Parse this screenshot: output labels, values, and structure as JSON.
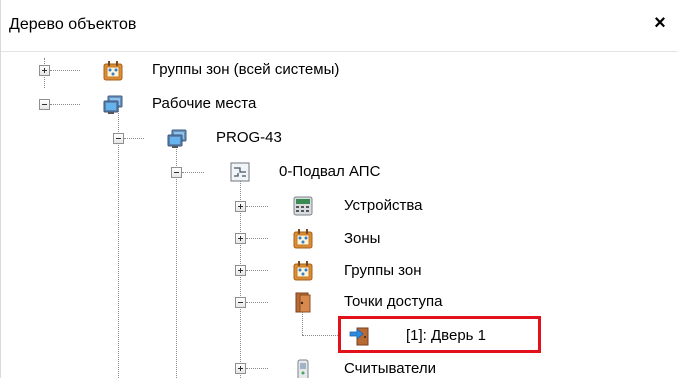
{
  "panel": {
    "title": "Дерево объектов",
    "close_symbol": "×"
  },
  "tree": {
    "nodes": [
      {
        "label": "Группы зон (всей системы)",
        "icon": "zone-group-icon",
        "state": "collapsed"
      },
      {
        "label": "Рабочие места",
        "icon": "workstations-icon",
        "state": "expanded"
      },
      {
        "label": "PROG-43",
        "icon": "computer-icon",
        "state": "expanded"
      },
      {
        "label": "0-Подвал АПС",
        "icon": "floor-plan-icon",
        "state": "expanded"
      },
      {
        "label": "Устройства",
        "icon": "devices-icon",
        "state": "collapsed"
      },
      {
        "label": "Зоны",
        "icon": "zones-icon",
        "state": "collapsed"
      },
      {
        "label": "Группы зон",
        "icon": "zone-group-icon",
        "state": "collapsed"
      },
      {
        "label": "Точки доступа",
        "icon": "access-points-icon",
        "state": "expanded"
      },
      {
        "label": "[1]: Дверь 1",
        "icon": "door-icon",
        "state": "leaf",
        "highlighted": true
      },
      {
        "label": "Считыватели",
        "icon": "reader-icon",
        "state": "collapsed"
      }
    ]
  },
  "colors": {
    "highlight": "#e3111b",
    "tree_line": "#8a8a8a"
  }
}
